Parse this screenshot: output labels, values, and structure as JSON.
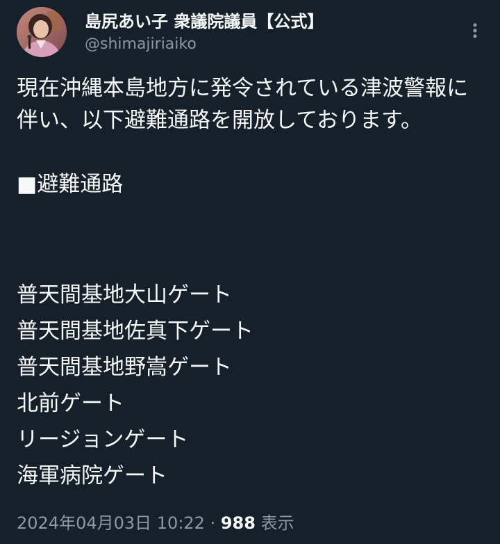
{
  "author": {
    "display_name": "島尻あい子 衆議院議員【公式】",
    "handle": "@shimajiriaiko",
    "avatar_icon": "profile-photo"
  },
  "more_icon": "more-vertical-icon",
  "tweet": {
    "paragraph": "現在沖縄本島地方に発令されている津波警報に伴い、以下避難通路を開放しております。",
    "heading": "■避難通路",
    "routes": [
      "普天間基地大山ゲート",
      "普天間基地佐真下ゲート",
      "普天間基地野嵩ゲート",
      "北前ゲート",
      "リージョンゲート",
      "海軍病院ゲート"
    ]
  },
  "meta": {
    "timestamp": "2024年04月03日 10:22",
    "separator": " · ",
    "views_count": "988",
    "views_label": " 表示"
  },
  "colors": {
    "background": "#15202b",
    "text": "#f7f9f9",
    "secondary": "#8b98a5"
  }
}
